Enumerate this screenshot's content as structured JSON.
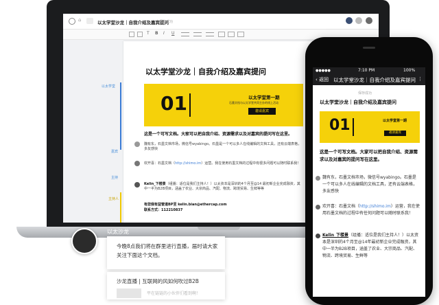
{
  "laptop": {
    "doc_header": {
      "doc_title": "以太学堂沙龙｜自我介绍及嘉宾提问",
      "save_status": "保存成功"
    },
    "comment_labels": [
      "以太学堂",
      "嘉宾",
      "主持",
      "主持人"
    ],
    "document": {
      "title": "以太学堂沙龙｜自我介绍及嘉宾提问",
      "cover": {
        "number": "01",
        "heading": "以太学堂第一期",
        "sub": "石墨文档与以太学堂共同主办的线上活动",
        "button": "邀请嘉宾"
      },
      "intro": "这是一个可写文档。大家可以把自我介绍、资源需求以及对嘉宾的提问写在这里。",
      "entry1": "魏有东，石墨文档市场，微信号wyabingo。石墨是一个可以多人在线编辑的文档工具，还有云端表格，多友感快",
      "entry2_prefix": "欢开喜：石墨文档（",
      "entry2_link": "http://shimo.im",
      "entry2_rest": "）运营。我在使用石墨文档的过程中有很多问题可以随时联系我！",
      "entry3_name": "Kelin_下楼景",
      "entry3_text": "（组播：适位是我们主持人！）以太资本是深圳的4个月至@14 最初新企业完成融资，其中一半为B2B项目，涵盖了农业、大宗商品、汽配、物流、跨境贸易、生鲜等等",
      "entry3_email": "有您我有益管道BP至 kelin.bian@ethercap.com",
      "entry3_phone": "联系方式：112210837"
    }
  },
  "phone": {
    "status": {
      "time": "7:10 PM",
      "battery": "100%"
    },
    "nav": {
      "back": "返回",
      "title": "以太学堂沙龙｜自我介绍及嘉宾提问"
    },
    "save_status": "保存成功",
    "document": {
      "title": "以太学堂沙龙｜自我介绍及嘉宾提问",
      "cover_number": "01",
      "cover_heading": "以太学堂第一期",
      "cover_button": "邀请嘉宾",
      "intro": "这是一个可写文档。大家可以把自我介绍、资源需求以及对嘉宾的提问写在这里。",
      "entry1": "魏有东，石墨文档市场，微信号wyabingo。石墨是一个可以多人在线编辑的文档工具，还有云端表格，多友感快",
      "entry2_prefix": "欢开喜：石墨文档（",
      "entry2_link": "http://shimo.im",
      "entry2_rest": "）运营，我在使用石墨文档的过程中有任何问题可以随时联系我！",
      "entry3_name": "Kelin_下楼景",
      "entry3_text": "（组播：适位是我们主持人！）以太资本是深圳的4个月至@14年最初新企业完成融资，其中一半为B2B项目，涵盖了农业、大宗商品、汽配、物流、跨境贸易、生鲜等"
    }
  },
  "chat": {
    "user_name": "以太沙龙",
    "message": "今晚8点我们将在群里进行直播，届时请大家关注下面这个文档。",
    "card2_title": "沙龙直播 | 互联网的风如何吹过B2B",
    "card2_sub": "平在链链的小伙伴们看到啊！"
  }
}
